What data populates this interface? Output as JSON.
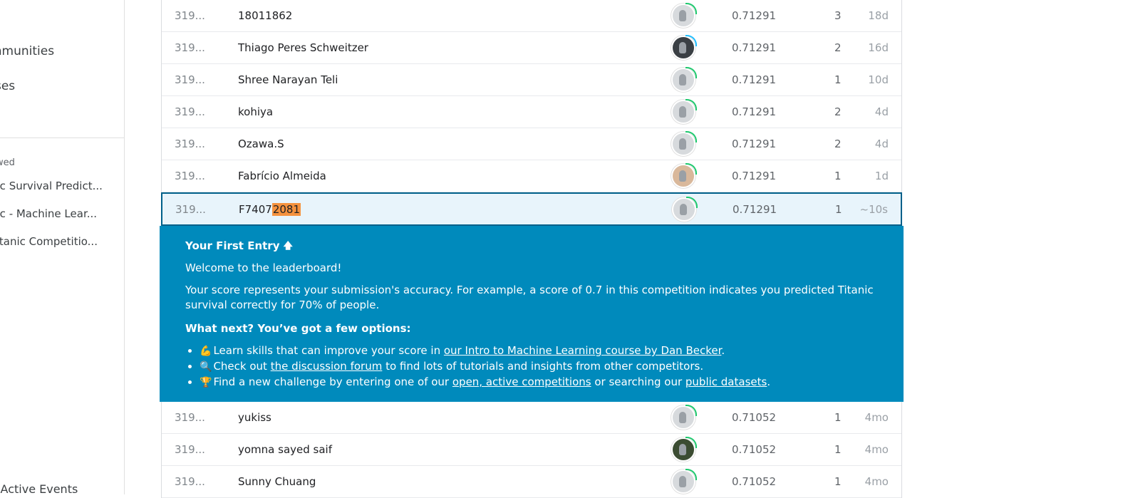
{
  "sidebar": {
    "nav": [
      "e",
      "mmunities",
      "rses",
      "e"
    ],
    "recent_heading": "ewed",
    "recent": [
      "nic Survival Predict...",
      "nic - Machine Lear...",
      "Titanic Competitio..."
    ],
    "active_events": "y Active Events"
  },
  "rows_before": [
    {
      "rank": "319...",
      "team": "18011862",
      "avatar": "default",
      "score": "0.71291",
      "entries": "3",
      "last": "18d"
    },
    {
      "rank": "319...",
      "team": "Thiago Peres Schweitzer",
      "avatar": "photo-dark",
      "score": "0.71291",
      "entries": "2",
      "last": "16d"
    },
    {
      "rank": "319...",
      "team": "Shree Narayan Teli",
      "avatar": "default",
      "score": "0.71291",
      "entries": "1",
      "last": "10d"
    },
    {
      "rank": "319...",
      "team": "kohiya",
      "avatar": "default",
      "score": "0.71291",
      "entries": "2",
      "last": "4d"
    },
    {
      "rank": "319...",
      "team": "Ozawa.S",
      "avatar": "default",
      "score": "0.71291",
      "entries": "2",
      "last": "4d"
    },
    {
      "rank": "319...",
      "team": "Fabrício Almeida",
      "avatar": "photo-skin",
      "score": "0.71291",
      "entries": "1",
      "last": "1d"
    }
  ],
  "current": {
    "rank": "319...",
    "team_prefix": "F7407",
    "team_highlight": "2081",
    "score": "0.71291",
    "entries": "1",
    "last": "~10s"
  },
  "info": {
    "title": "Your First Entry",
    "welcome": "Welcome to the leaderboard!",
    "score_text": "Your score represents your submission's accuracy. For example, a score of 0.7 in this competition indicates you predicted Titanic survival correctly for 70% of people.",
    "what_next": "What next? You’ve got a few options:",
    "opt1_pre": "Learn skills that can improve your score in ",
    "opt1_link": "our Intro to Machine Learning course by Dan Becker",
    "opt1_post": ".",
    "opt2_pre": "Check out ",
    "opt2_link": "the discussion forum",
    "opt2_post": " to find lots of tutorials and insights from other competitors.",
    "opt3_pre": "Find a new challenge by entering one of our ",
    "opt3_link1": "open, active competitions",
    "opt3_mid": " or searching our ",
    "opt3_link2": "public datasets",
    "opt3_post": "."
  },
  "rows_after": [
    {
      "rank": "319...",
      "team": "yukiss",
      "avatar": "default",
      "score": "0.71052",
      "entries": "1",
      "last": "4mo"
    },
    {
      "rank": "319...",
      "team": "yomna sayed saif",
      "avatar": "photo-forest",
      "score": "0.71052",
      "entries": "1",
      "last": "4mo"
    },
    {
      "rank": "319...",
      "team": "Sunny Chuang",
      "avatar": "default",
      "score": "0.71052",
      "entries": "1",
      "last": "4mo"
    }
  ],
  "colors": {
    "accent": "#008abc",
    "highlight_border": "#00608a",
    "mark": "#f5923e"
  }
}
